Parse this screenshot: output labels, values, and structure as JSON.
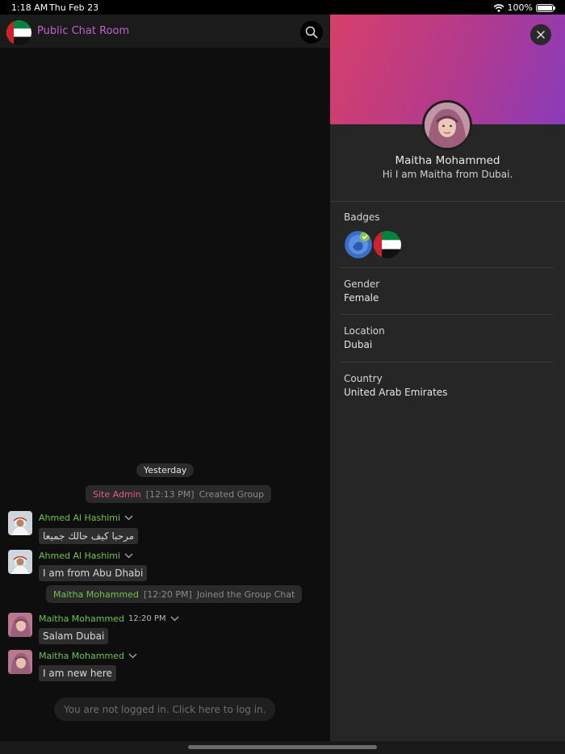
{
  "status_bar": {
    "time": "1:18 AM",
    "date": "Thu Feb 23",
    "battery": "100%"
  },
  "chat": {
    "title": "Public Chat Room",
    "day_separator": "Yesterday",
    "system_messages": [
      {
        "name": "Site Admin",
        "time": "[12:13 PM]",
        "text": "Created Group"
      },
      {
        "name": "Maitha Mohammed",
        "time": "[12:20 PM]",
        "text": "Joined the Group Chat"
      }
    ],
    "messages": [
      {
        "name": "Ahmed Al Hashimi",
        "time": "",
        "text": "مرحبا كيف حالك جميعا"
      },
      {
        "name": "Ahmed Al Hashimi",
        "time": "",
        "text": "I am from Abu Dhabi"
      },
      {
        "name": "Maitha Mohammed",
        "time": "12:20 PM",
        "text": "Salam Dubai"
      },
      {
        "name": "Maitha Mohammed",
        "time": "",
        "text": "I am new here"
      }
    ],
    "login_prompt": "You are not logged in. Click here to log in."
  },
  "profile": {
    "name": "Maitha Mohammed",
    "bio": "Hi I am Maitha from Dubai.",
    "badges_label": "Badges",
    "fields": [
      {
        "label": "Gender",
        "value": "Female"
      },
      {
        "label": "Location",
        "value": "Dubai"
      },
      {
        "label": "Country",
        "value": "United Arab Emirates"
      }
    ]
  },
  "icons": {
    "search": "search-icon",
    "close": "close-icon",
    "chevron": "chevron-down-icon",
    "wifi": "wifi-icon",
    "battery": "battery-icon"
  },
  "colors": {
    "room_title": "#c55fce",
    "username": "#6fc44a",
    "admin": "#e05c8e",
    "cover_start": "#d63f6a",
    "cover_end": "#8a3bbb"
  }
}
